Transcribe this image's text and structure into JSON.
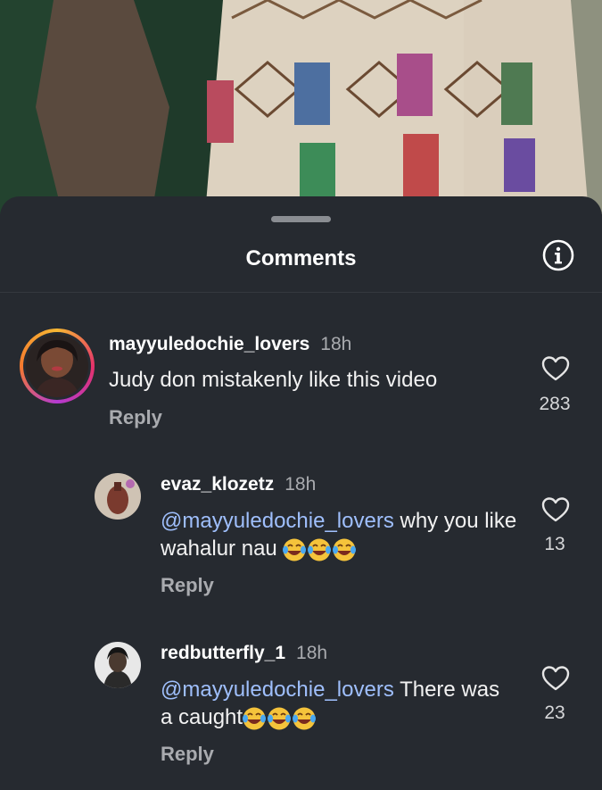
{
  "sheet": {
    "title": "Comments"
  },
  "comments": [
    {
      "username": "mayyuledochie_lovers",
      "time": "18h",
      "text": "Judy don mistakenly like this video",
      "reply": "Reply",
      "likes": "283"
    },
    {
      "username": "evaz_klozetz",
      "time": "18h",
      "mention": "@mayyuledochie_lovers",
      "text": " why you like wahalur nau ",
      "reply": "Reply",
      "likes": "13"
    },
    {
      "username": "redbutterfly_1",
      "time": "18h",
      "mention": "@mayyuledochie_lovers",
      "text": " There was a caught",
      "reply": "Reply",
      "likes": "23"
    }
  ],
  "icons": [
    "info-icon",
    "heart-icon",
    "laughing-emoji-icon"
  ],
  "colors": {
    "background": "#262a30",
    "mention": "#9fbffc",
    "muted": "#a9abaf"
  }
}
